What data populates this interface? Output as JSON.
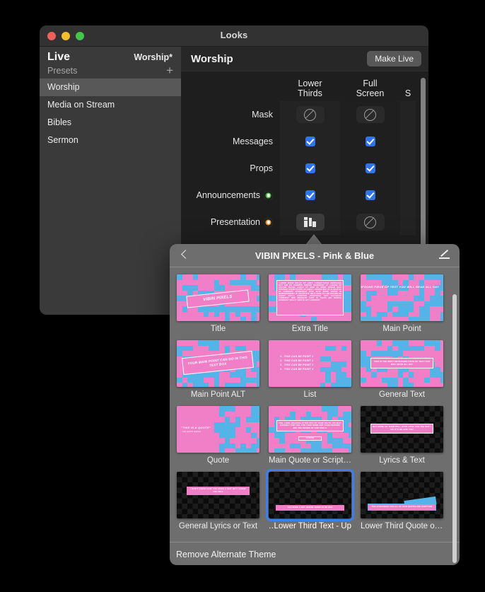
{
  "window": {
    "title": "Looks",
    "traffic_lights": [
      "close",
      "minimize",
      "zoom"
    ]
  },
  "sidebar": {
    "live_label": "Live",
    "live_value": "Worship*",
    "presets_label": "Presets",
    "add_label": "+",
    "items": [
      {
        "label": "Worship",
        "selected": true
      },
      {
        "label": "Media on Stream",
        "selected": false
      },
      {
        "label": "Bibles",
        "selected": false
      },
      {
        "label": "Sermon",
        "selected": false
      }
    ]
  },
  "detail": {
    "title": "Worship",
    "make_live_label": "Make Live",
    "columns": [
      {
        "line1": "Lower",
        "line2": "Thirds"
      },
      {
        "line1": "Full",
        "line2": "Screen"
      },
      {
        "line1": "S",
        "line2": ""
      }
    ],
    "rows": [
      {
        "label": "Mask",
        "indicator": "",
        "lower_thirds": "disabled",
        "full_screen": "disabled"
      },
      {
        "label": "Messages",
        "indicator": "",
        "lower_thirds": "checked",
        "full_screen": "checked"
      },
      {
        "label": "Props",
        "indicator": "",
        "lower_thirds": "checked",
        "full_screen": "checked"
      },
      {
        "label": "Announcements",
        "indicator": "green",
        "lower_thirds": "checked",
        "full_screen": "checked"
      },
      {
        "label": "Presentation",
        "indicator": "orange",
        "lower_thirds": "presentation",
        "full_screen": "disabled"
      }
    ]
  },
  "popover": {
    "title": "VIBIN PIXELS - Pink & Blue",
    "back_icon": "chevron-left-icon",
    "edit_icon": "pencil-icon",
    "footer_label": "Remove Alternate Theme",
    "themes": [
      {
        "caption": "Title",
        "selected": false,
        "art": "title"
      },
      {
        "caption": "Extra Title",
        "selected": false,
        "art": "extra-title"
      },
      {
        "caption": "Main Point",
        "selected": false,
        "art": "main-point"
      },
      {
        "caption": "Main Point ALT",
        "selected": false,
        "art": "main-point-alt"
      },
      {
        "caption": "List",
        "selected": false,
        "art": "list"
      },
      {
        "caption": "General Text",
        "selected": false,
        "art": "general-text"
      },
      {
        "caption": "Quote",
        "selected": false,
        "art": "quote"
      },
      {
        "caption": "Main Quote or Script…",
        "selected": false,
        "art": "main-quote"
      },
      {
        "caption": "Lyrics & Text",
        "selected": false,
        "art": "lyrics-text"
      },
      {
        "caption": "General Lyrics or Text",
        "selected": false,
        "art": "general-lyrics"
      },
      {
        "caption": "Lower Third Text - Up…",
        "selected": true,
        "art": "lower-third-text"
      },
      {
        "caption": "Lower Third Quote or…",
        "selected": false,
        "art": "lower-third-quote"
      }
    ],
    "slide_text": {
      "title": "VIBIN PIXELS",
      "extra_title": "\"LOREM IPSUM DOLOR SIT AMET, CONSECTETUR ADIPISCING ELIT SED DO EIUSMOD TEMPOR INCIDIDUNT UT LABORE ET DOLORE MAGNA ALIQUA UT ENIM AD MINIM VENIAM QUIS NOSTRUD EXERCITATION ULLAMCO LABORIS NISI UT ALIQUIP EX EA COMMODO CONSEQUAT DUIS AUTE IRURE DOLOR IN REPREHENDERIT IN VOLUPTATE VELIT ESSE CILLUM DOLORE EU FUGIAT NULLA PARIATUR EXCEPTEUR SINT OCCAECAT CUPIDATAT NON PROIDENT SUNT IN CULPA QUI OFFICIA DESERUNT MOLLIT ANIM ID EST LABORUM.\"",
      "main_point": "THIS IS THE MOST PROFOUND PIECE OF TEXT YOU WILL READ ALL DAY",
      "main_point_alt": "YOUR MAIN POINT CAN GO IN THIS TEXT BOX",
      "list": [
        "1.  THIS CAN BE POINT 1",
        "2.  THIS CAN BE POINT 2",
        "3.  THIS CAN BE POINT 3",
        "4.  THIS CAN BE POINT 4"
      ],
      "general_text": "THIS IS THE MOST PROFOUND PIECE OF TEXT YOU WILL READ ALL DAY",
      "quote": "\"THIS IS A QUOTE\"",
      "quote_author": "- THE QUOTE MAKER",
      "main_quote": "YOU, LORD, WALKING IN THE WAY OF YOUR TRUTH, WE WAIT EAGERLY FOR YOU, FOR YOUR NAME AND YOUR RENOWN ARE THE DESIRE OF OUR SOULS.",
      "main_quote_author": "AUTHOR",
      "lyrics_text": "BUT NONE OF THEM WILL EVER LOVE YOU THE WAY I DO IT'S ME AND YOU",
      "general_lyrics": "I DON'T KNOW HOW YOU MAKE A WAY BUT I KNOW YOU WILL",
      "lower_third_text": "YOU MAKE A WAY WHERE THERE IS NO WAY",
      "lower_third_quote": "THIS ATTACHMENT FOR ALL OF YOUR QUOTES AND SCRIPTURE"
    }
  },
  "colors": {
    "accent_blue": "#3c7ff0",
    "checkbox_blue": "#2f74e8",
    "theme_pink": "#f07fc8",
    "theme_blue": "#55b3e8",
    "indicator_green": "#3fbb3f",
    "indicator_orange": "#e8932a"
  }
}
